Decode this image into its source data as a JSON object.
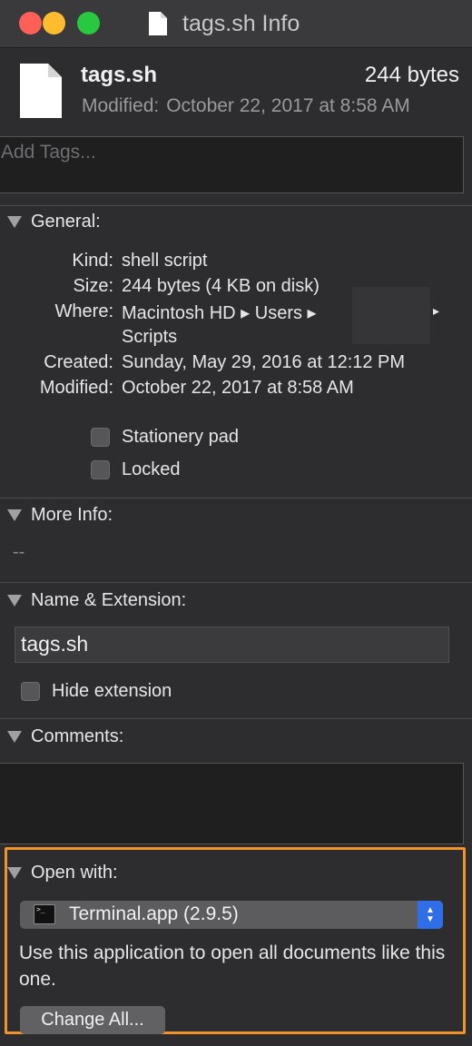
{
  "window": {
    "title": "tags.sh Info"
  },
  "header": {
    "file_name": "tags.sh",
    "file_size": "244 bytes",
    "modified_label": "Modified:",
    "modified_value": "October 22, 2017 at 8:58 AM"
  },
  "tags": {
    "placeholder": "Add Tags..."
  },
  "general": {
    "title": "General:",
    "kind_label": "Kind:",
    "kind_value": "shell script",
    "size_label": "Size:",
    "size_value": "244 bytes (4 KB on disk)",
    "where_label": "Where:",
    "where_line1": "Macintosh HD ▸ Users ▸",
    "where_arrow": "▸",
    "where_line2": "Scripts",
    "created_label": "Created:",
    "created_value": "Sunday, May 29, 2016 at 12:12 PM",
    "modified_label": "Modified:",
    "modified_value": "October 22, 2017 at 8:58 AM",
    "stationery_label": "Stationery pad",
    "locked_label": "Locked"
  },
  "more_info": {
    "title": "More Info:",
    "value": "--"
  },
  "name_ext": {
    "title": "Name & Extension:",
    "name_value": "tags.sh",
    "hide_ext_label": "Hide extension"
  },
  "comments": {
    "title": "Comments:"
  },
  "open_with": {
    "title": "Open with:",
    "app_selected": "Terminal.app (2.9.5)",
    "description": "Use this application to open all documents like this one.",
    "change_all_label": "Change All..."
  },
  "colors": {
    "highlight": "#f0932b",
    "popup_accent": "#2f6ee6"
  }
}
